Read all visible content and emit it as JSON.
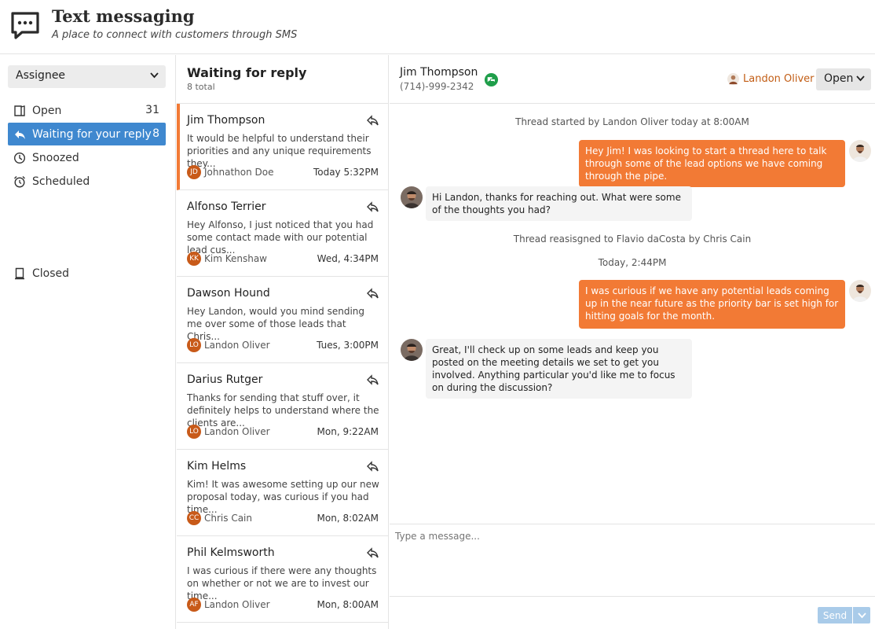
{
  "app": {
    "title": "Text messaging",
    "subtitle": "A place to connect with customers through SMS",
    "icon": "chat-bubble-icon"
  },
  "sidebar": {
    "assignee_label": "Assignee",
    "items": [
      {
        "label": "Open",
        "count": "31",
        "icon": "inbox-icon",
        "active": false
      },
      {
        "label": "Waiting for your reply",
        "count": "8",
        "icon": "reply-icon",
        "active": true
      },
      {
        "label": "Snoozed",
        "count": "",
        "icon": "clock-icon",
        "active": false
      },
      {
        "label": "Scheduled",
        "count": "",
        "icon": "alarm-icon",
        "active": false
      },
      {
        "label": "Closed",
        "count": "",
        "icon": "bookmark-icon",
        "active": false
      }
    ]
  },
  "list": {
    "title": "Waiting for reply",
    "count": "8 total",
    "conversations": [
      {
        "name": "Jim Thompson",
        "preview": "It would be helpful to understand their priorities and any unique requirements they...",
        "initials": "JD",
        "assignee": "Johnathon Doe",
        "time": "Today 5:32PM",
        "selected": true
      },
      {
        "name": "Alfonso Terrier",
        "preview": "Hey Alfonso, I just noticed that you had some contact made with our potential lead cus...",
        "initials": "KK",
        "assignee": "Kim Kenshaw",
        "time": "Wed, 4:34PM",
        "selected": false
      },
      {
        "name": "Dawson Hound",
        "preview": "Hey Landon, would you mind sending me over some of those leads that Chris...",
        "initials": "LO",
        "assignee": "Landon Oliver",
        "time": "Tues, 3:00PM",
        "selected": false
      },
      {
        "name": "Darius Rutger",
        "preview": "Thanks for sending that stuff over, it definitely helps to understand where the clients are...",
        "initials": "LO",
        "assignee": "Landon Oliver",
        "time": "Mon, 9:22AM",
        "selected": false
      },
      {
        "name": "Kim Helms",
        "preview": "Kim! It was awesome setting up our new proposal today, was curious if you had time...",
        "initials": "CC",
        "assignee": "Chris Cain",
        "time": "Mon, 8:02AM",
        "selected": false
      },
      {
        "name": "Phil Kelmsworth",
        "preview": "I was curious if there were any thoughts on whether or not we are to invest our time...",
        "initials": "AF",
        "assignee": "Landon Oliver",
        "time": "Mon, 8:00AM",
        "selected": false
      }
    ]
  },
  "thread": {
    "contact_name": "Jim Thompson",
    "contact_phone": "(714)-999-2342",
    "owner": "Landon Oliver",
    "status": "Open",
    "messages": [
      {
        "type": "system",
        "text": "Thread started by Landon Oliver today at 8:00AM"
      },
      {
        "type": "out",
        "text": "Hey Jim! I was looking to start a thread here to talk through some of the lead options we have coming through the pipe."
      },
      {
        "type": "in",
        "text": "Hi Landon, thanks for reaching out. What were some of the thoughts you had?"
      },
      {
        "type": "system",
        "text": "Thread reasisgned to Flavio daCosta by Chris Cain"
      },
      {
        "type": "system",
        "text": "Today, 2:44PM"
      },
      {
        "type": "out",
        "text": "I was curious if we have any potential leads coming up in the near future as the priority bar is set high for hitting goals for the month."
      },
      {
        "type": "in",
        "text": "Great, I'll check up on some leads and keep you posted on the meeting details we set to get you involved. Anything particular you'd like me to focus on during the discussion?"
      }
    ],
    "composer_placeholder": "Type a message...",
    "send_label": "Send"
  },
  "colors": {
    "accent_orange": "#f27a35",
    "active_blue": "#3f88cf",
    "initials_bg": "#c85a19",
    "send_disabled": "#a9cbe9",
    "chat_green": "#1f9e4a"
  }
}
